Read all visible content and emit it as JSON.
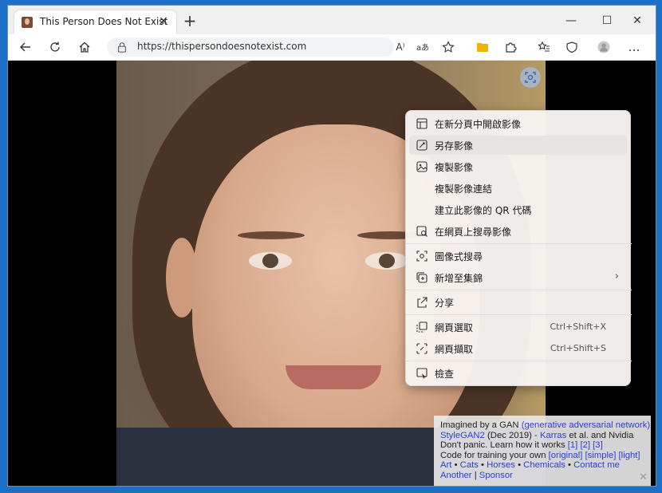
{
  "browser": {
    "tab_title": "This Person Does Not Exist",
    "tab_close": "✕",
    "new_tab": "+",
    "minimize": "—",
    "maximize": "☐",
    "close": "✕",
    "url": "https://thispersondoesnotexist.com",
    "read_aloud": "A⁾",
    "more": "…"
  },
  "context_menu": {
    "items": [
      {
        "label": "在新分頁中開啟影像",
        "icon": "new-tab-icon"
      },
      {
        "label": "另存影像",
        "icon": "save-image-icon"
      },
      {
        "label": "複製影像",
        "icon": "copy-image-icon"
      },
      {
        "label": "複製影像連結",
        "icon": ""
      },
      {
        "label": "建立此影像的 QR 代碼",
        "icon": ""
      },
      {
        "label": "在網頁上搜尋影像",
        "icon": "search-image-icon"
      },
      {
        "label": "圖像式搜尋",
        "icon": "visual-search-icon"
      },
      {
        "label": "新增至集錦",
        "icon": "collections-icon",
        "arrow": "›"
      },
      {
        "label": "分享",
        "icon": "share-icon"
      },
      {
        "label": "網頁選取",
        "icon": "web-select-icon",
        "shortcut": "Ctrl+Shift+X"
      },
      {
        "label": "網頁擷取",
        "icon": "web-capture-icon",
        "shortcut": "Ctrl+Shift+S"
      },
      {
        "label": "檢查",
        "icon": "inspect-icon"
      }
    ]
  },
  "info_box": {
    "line1_text": "Imagined by a GAN ",
    "line1_link": "(generative adversarial network)",
    "line2_link1": "StyleGAN2",
    "line2_text1": " (Dec 2019) - ",
    "line2_link2": "Karras",
    "line2_text2": " et al. and Nvidia",
    "line3_text": "Don't panic. Learn how it works ",
    "line3_links": [
      "[1]",
      "[2]",
      "[3]"
    ],
    "line4_text": "Code for training your own ",
    "line4_links": [
      "[original]",
      "[simple]",
      "[light]"
    ],
    "line5_links": [
      "Art",
      "Cats",
      "Horses",
      "Chemicals",
      "Contact me"
    ],
    "line6_link1": "Another",
    "line6_sep": " | ",
    "line6_link2": "Sponsor",
    "close": "✕"
  }
}
